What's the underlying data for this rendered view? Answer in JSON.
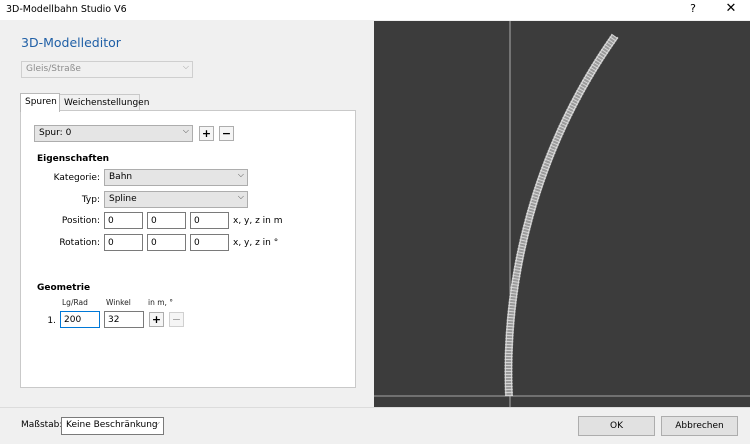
{
  "window": {
    "title": "3D-Modellbahn Studio V6",
    "help": "?",
    "close": "✕"
  },
  "editor": {
    "heading": "3D-Modelleditor",
    "type_select": "Gleis/Straße",
    "tabs": [
      "Spuren",
      "Weichenstellungen"
    ],
    "track_select": "Spur: 0",
    "add": "+",
    "remove": "−"
  },
  "properties": {
    "section": "Eigenschaften",
    "category_label": "Kategorie:",
    "category_value": "Bahn",
    "type_label": "Typ:",
    "type_value": "Spline",
    "position_label": "Position:",
    "position": [
      "0",
      "0",
      "0"
    ],
    "position_unit": "x, y, z in m",
    "rotation_label": "Rotation:",
    "rotation": [
      "0",
      "0",
      "0"
    ],
    "rotation_unit": "x, y, z in °"
  },
  "geometry": {
    "section": "Geometrie",
    "col_length": "Lg/Rad",
    "col_angle": "Winkel",
    "col_unit": "in m, °",
    "row_index": "1.",
    "length": "200",
    "angle": "32",
    "add": "+",
    "remove": "−"
  },
  "footer": {
    "scale_label": "Maßstab:",
    "scale_value": "Keine Beschränkung",
    "ok": "OK",
    "cancel": "Abbrechen"
  },
  "icons": {
    "dropdown": "chevron-down-icon"
  },
  "colors": {
    "accent": "#1f5fa6",
    "viewport_bg": "#3c3c3c"
  }
}
